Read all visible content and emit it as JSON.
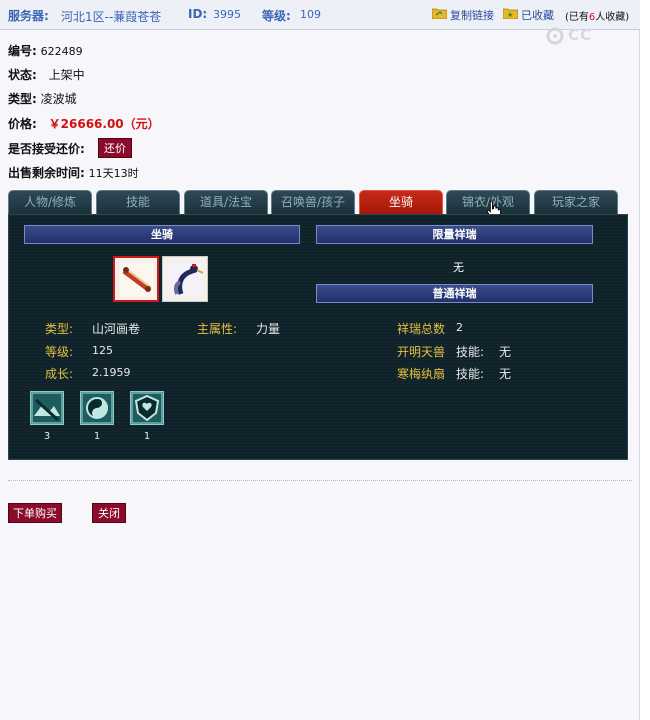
{
  "header": {
    "server_label": "服务器:",
    "server_value": "河北1区--蒹葭苍苍",
    "id_label": "ID:",
    "id_value": "3995",
    "level_label": "等级:",
    "level_value": "109",
    "copy_link": "复制链接",
    "favorited": "已收藏",
    "fav_prefix": "(已有",
    "fav_count": "6",
    "fav_suffix": "人收藏)"
  },
  "watermark": "CC",
  "info": {
    "number_label": "编号:",
    "number_value": "622489",
    "status_label": "状态:",
    "status_value": "上架中",
    "type_label": "类型:",
    "type_value": "凌波城",
    "price_label": "价格:",
    "price_value": "￥26666.00（元）",
    "counter_label": "是否接受还价:",
    "counter_button": "还价",
    "remaining_label": "出售剩余时间:",
    "remaining_value": "11天13时"
  },
  "tabs": [
    {
      "label": "人物/修炼",
      "active": false
    },
    {
      "label": "技能",
      "active": false
    },
    {
      "label": "道具/法宝",
      "active": false
    },
    {
      "label": "召唤兽/孩子",
      "active": false
    },
    {
      "label": "坐骑",
      "active": true
    },
    {
      "label": "锦衣/外观",
      "active": false
    },
    {
      "label": "玩家之家",
      "active": false
    }
  ],
  "mount_panel": {
    "mount_header": "坐骑",
    "limited_header": "限量祥瑞",
    "limited_value": "无",
    "normal_header": "普通祥瑞",
    "items": [
      {
        "icon": "scroll-icon",
        "selected": true
      },
      {
        "icon": "crane-icon",
        "selected": false
      }
    ],
    "type_label": "类型:",
    "type_value": "山河画卷",
    "main_attr_label": "主属性:",
    "main_attr_value": "力量",
    "level_label": "等级:",
    "level_value": "125",
    "growth_label": "成长:",
    "growth_value": "2.1959",
    "total_label": "祥瑞总数",
    "total_value": "2",
    "beast1_label": "开明天兽",
    "beast1_skill_label": "技能:",
    "beast1_skill_value": "无",
    "beast2_label": "寒梅纨扇",
    "beast2_skill_label": "技能:",
    "beast2_skill_value": "无",
    "skills": [
      {
        "icon": "mountain-skill-icon",
        "count": "3"
      },
      {
        "icon": "yinyang-skill-icon",
        "count": "1"
      },
      {
        "icon": "shield-skill-icon",
        "count": "1"
      }
    ]
  },
  "actions": {
    "buy": "下单购买",
    "close": "关闭"
  },
  "colors": {
    "accent_red": "#8a0c2a",
    "price_red": "#d01010",
    "panel_bg": "#0f2229",
    "active_tab": "#c82a18",
    "label_gold": "#e4c040"
  }
}
